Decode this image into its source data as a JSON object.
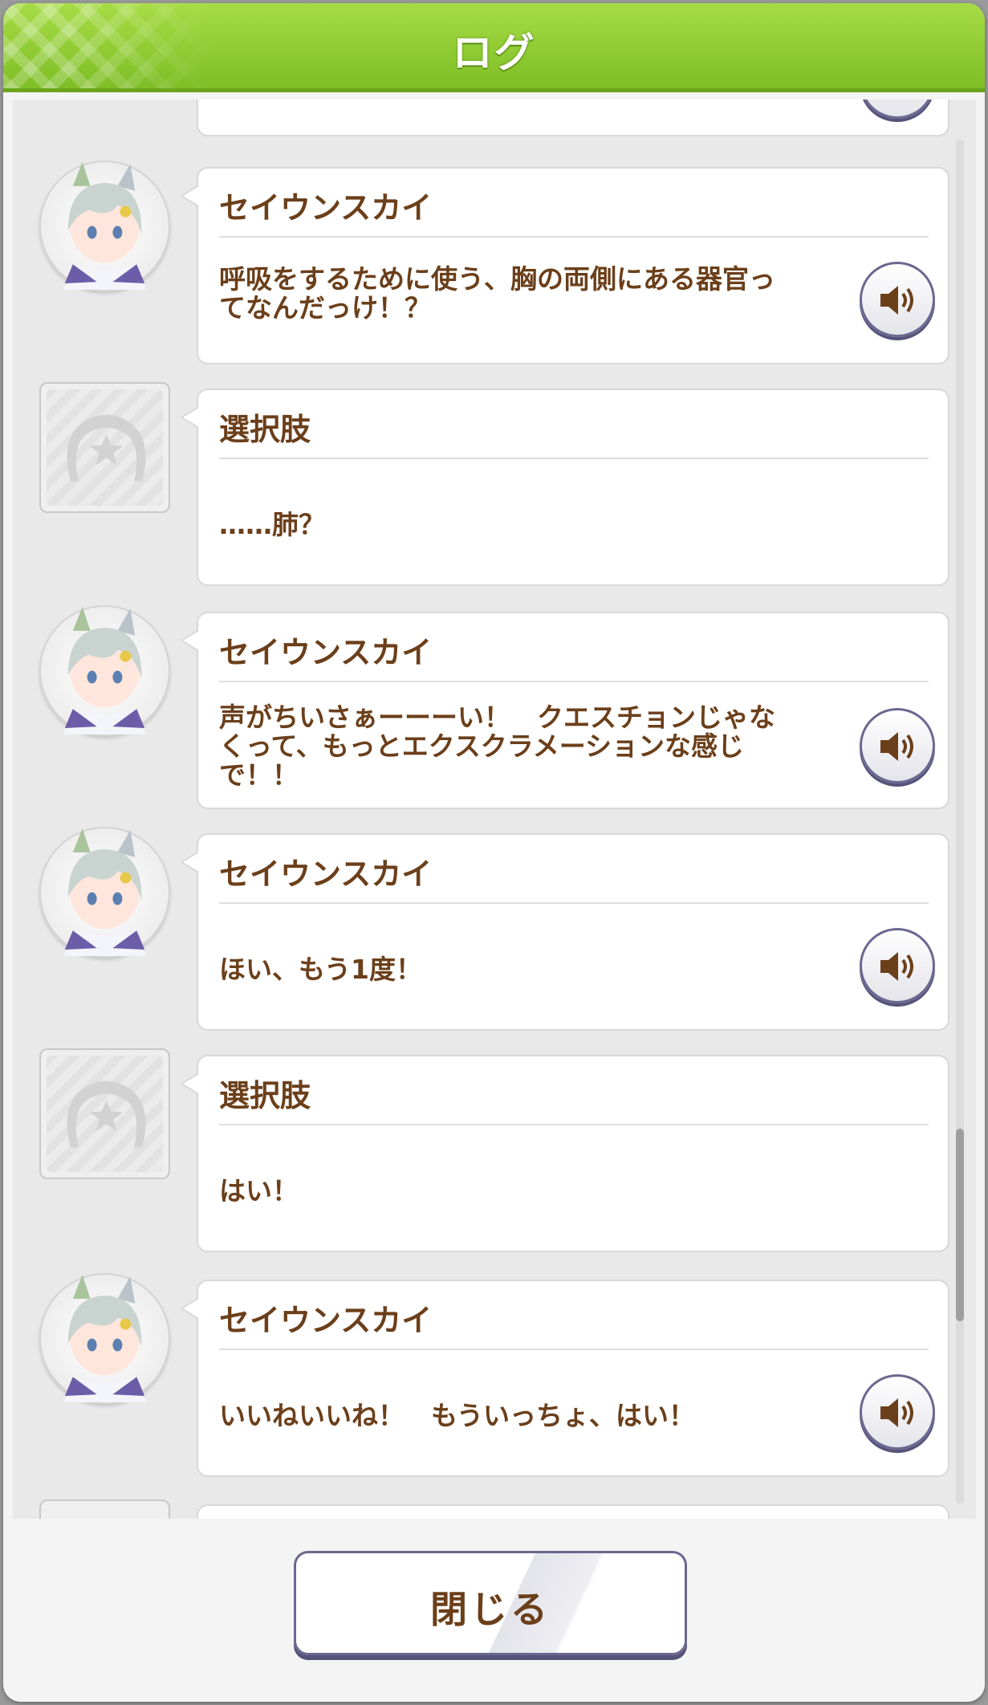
{
  "header": {
    "title": "ログ"
  },
  "entries": [
    {
      "speaker": "セイウンスカイ",
      "text": "呼吸をするために使う、胸の両側にある器官っ\nてなんだっけ！？",
      "type": "character",
      "has_voice": true
    },
    {
      "speaker": "選択肢",
      "text": "……肺？",
      "type": "choice",
      "has_voice": false
    },
    {
      "speaker": "セイウンスカイ",
      "text": "声がちいさぁーーーい！　クエスチョンじゃな\nくって、もっとエクスクラメーションな感じ\nで！！",
      "type": "character",
      "has_voice": true
    },
    {
      "speaker": "セイウンスカイ",
      "text": "ほい、もう1度！",
      "type": "character",
      "has_voice": true
    },
    {
      "speaker": "選択肢",
      "text": "はい！",
      "type": "choice",
      "has_voice": false
    },
    {
      "speaker": "セイウンスカイ",
      "text": "いいねいいね！　もういっちょ、はい！",
      "type": "character",
      "has_voice": true
    }
  ],
  "footer": {
    "close_label": "閉じる"
  },
  "colors": {
    "header": "#8fcf2e",
    "text": "#6b3f1a",
    "button_border": "#6a6890"
  },
  "icons": {
    "voice": "speaker-icon",
    "choice": "horseshoe-icon",
    "character": "character-portrait"
  }
}
